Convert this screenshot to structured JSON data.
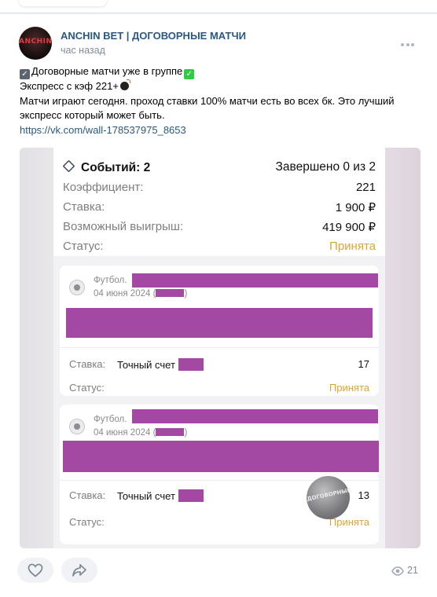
{
  "post": {
    "group_name": "ANCHIN BET | ДОГОВОРНЫЕ МАТЧИ",
    "avatar_text": "ANCHIN",
    "time": "час назад",
    "text_line1": "Договорные матчи уже в группе",
    "text_line2": "Экспресс с кэф 221+",
    "text_line3": "Матчи играют сегодня. проход ставки 100% матчи есть во всех бк. Это лучший экспресс который может быть.",
    "link": "https://vk.com/wall-178537975_8653",
    "views": "21"
  },
  "coupon": {
    "events_label": "Событий: 2",
    "completed_label": "Завершено 0 из 2",
    "rows": [
      {
        "label": "Коэффициент:",
        "value": "221"
      },
      {
        "label": "Ставка:",
        "value": "1 900 ₽"
      },
      {
        "label": "Возможный выигрыш:",
        "value": "419 900 ₽"
      }
    ],
    "status_label": "Статус:",
    "status_value": "Принята",
    "events": [
      {
        "sport": "Футбол.",
        "date": "04 июня 2024",
        "bet_label": "Ставка:",
        "bet_type": "Точный счет",
        "odds": "17",
        "status_label": "Статус:",
        "status": "Принята"
      },
      {
        "sport": "Футбол.",
        "date": "04 июня 2024",
        "bet_label": "Ставка:",
        "bet_type": "Точный счет",
        "odds": "13",
        "status_label": "Статус:",
        "status": "Принята"
      }
    ],
    "watermark_text": "ДОГОВОРНЫЕ"
  },
  "colors": {
    "link": "#2a5885",
    "accepted": "#e0a33a",
    "redaction": "#a349a4"
  },
  "icons": [
    "more-icon",
    "like-icon",
    "share-icon",
    "views-icon",
    "football-icon",
    "events-stack-icon"
  ]
}
